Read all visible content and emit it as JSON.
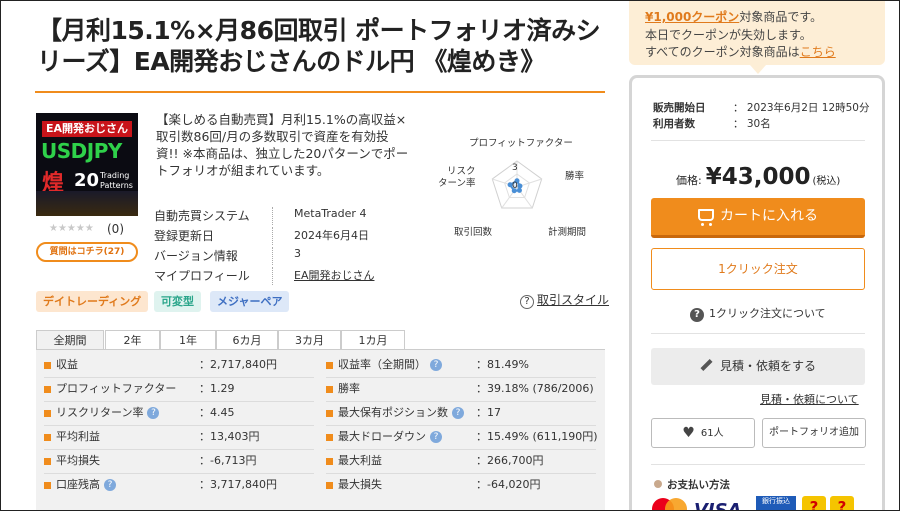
{
  "title": "【月利15.1%×月86回取引 ポートフォリオ済みシリーズ】EA開発おじさんのドル円 《煌めき》",
  "product_image": {
    "top_text": "EA開発おじさん",
    "pair": "USDJPY",
    "kanji": "煌",
    "count": "20",
    "sub1": "Trading",
    "sub2": "Patterns"
  },
  "rating": {
    "stars": "★★★★★",
    "count": "(0)"
  },
  "qa_button": "質問はコチラ(27)",
  "description": "【楽しめる自動売買】月利15.1%の高収益×取引数86回/月の多数取引で資産を有効投資!! ※本商品は、独立した20パターンでポートフォリオが組まれています。",
  "info": [
    {
      "label": "自動売買システム",
      "value": "MetaTrader 4"
    },
    {
      "label": "登録更新日",
      "value": "2024年6月4日"
    },
    {
      "label": "バージョン情報",
      "value": "3"
    },
    {
      "label": "マイプロフィール",
      "value": "EA開発おじさん"
    }
  ],
  "radar": {
    "labels": {
      "profit_factor": "プロフィットファクター",
      "win_rate": "勝率",
      "period": "計測期間",
      "trades": "取引回数",
      "risk_return_1": "リスク",
      "risk_return_2": "ターン率"
    },
    "scale_max": "3",
    "scale_min": "0",
    "values": {
      "profit_factor": 1.2,
      "win_rate": 0.6,
      "period": 0.8,
      "trades": 0.9,
      "risk_return": 1.4
    },
    "max": 5
  },
  "tags": [
    "デイトレーディング",
    "可変型",
    "メジャーペア"
  ],
  "trade_style": {
    "icon": "?",
    "label": "取引スタイル"
  },
  "tabs": [
    "全期間",
    "2年",
    "1年",
    "6カ月",
    "3カ月",
    "1カ月"
  ],
  "stats_left": [
    {
      "label": "収益",
      "value": "：2,717,840円",
      "help": false
    },
    {
      "label": "プロフィットファクター",
      "value": "：1.29",
      "help": false
    },
    {
      "label": "リスクリターン率",
      "value": "：4.45",
      "help": true
    },
    {
      "label": "平均利益",
      "value": "：13,403円",
      "help": false
    },
    {
      "label": "平均損失",
      "value": "：-6,713円",
      "help": false
    },
    {
      "label": "口座残高",
      "value": "：3,717,840円",
      "help": true
    }
  ],
  "stats_right": [
    {
      "label": "収益率（全期間）",
      "value": "：81.49%",
      "help": true
    },
    {
      "label": "勝率",
      "value": "：39.18% (786/2006)",
      "help": false
    },
    {
      "label": "最大保有ポジション数",
      "value": "：17",
      "help": true
    },
    {
      "label": "最大ドローダウン",
      "value": "：15.49% (611,190円)",
      "help": true
    },
    {
      "label": "最大利益",
      "value": "：266,700円",
      "help": false
    },
    {
      "label": "最大損失",
      "value": "：-64,020円",
      "help": false
    }
  ],
  "coupon": {
    "amount": "¥1,000クーポン",
    "line1_rest": "対象商品です。",
    "line2": "本日でクーポンが失効します。",
    "line3_pre": "すべてのクーポン対象商品は",
    "line3_link": "こちら"
  },
  "meta": [
    {
      "label": "販売開始日",
      "value": "：  2023年6月2日 12時50分"
    },
    {
      "label": "利用者数",
      "value": "：  30名"
    }
  ],
  "price": {
    "label": "価格:",
    "value": "¥43,000",
    "tax": "(税込)"
  },
  "buttons": {
    "cart": "カートに入れる",
    "oneclick": "1クリック注文",
    "oneclick_about": "1クリック注文について",
    "quote": "見積・依頼をする",
    "quote_about": "見積・依頼について",
    "favorite_count": "61人",
    "portfolio_add": "ポートフォリオ追加"
  },
  "payment": {
    "title": "お支払い方法",
    "visa": "VISA",
    "bank": "銀行振込",
    "q": "?"
  },
  "colors": {
    "accent": "#f08c1c",
    "coupon_bg": "#fdeed6",
    "radar": "#4a8fd6"
  }
}
